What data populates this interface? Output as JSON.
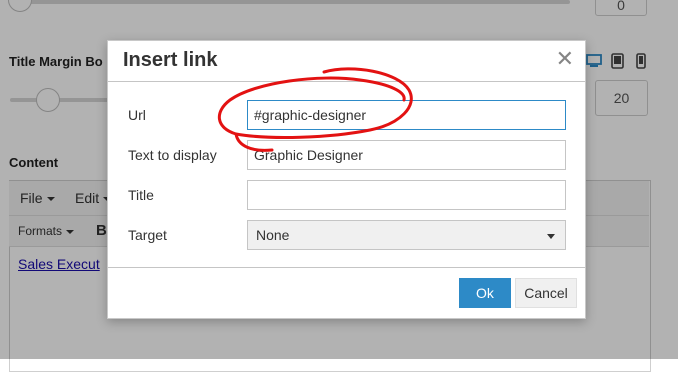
{
  "background": {
    "title_margin_label": "Title Margin Bo",
    "content_label": "Content",
    "slider_value": "20",
    "top_number_value": "0",
    "editor": {
      "menu_file": "File",
      "menu_edit": "Edit",
      "toolbar_formats": "Formats",
      "toolbar_bold": "B",
      "link_text": "Sales Execut"
    },
    "device_icons": [
      "desktop-icon",
      "tablet-icon",
      "mobile-icon"
    ]
  },
  "dialog": {
    "title": "Insert link",
    "close_glyph": "✕",
    "fields": {
      "url": {
        "label": "Url",
        "value": "#graphic-designer"
      },
      "text_to_display": {
        "label": "Text to display",
        "value": "Graphic Designer"
      },
      "title": {
        "label": "Title",
        "value": ""
      },
      "target": {
        "label": "Target",
        "value": "None"
      }
    },
    "ok_label": "Ok",
    "cancel_label": "Cancel"
  },
  "colors": {
    "primary_button": "#2d8ac7",
    "annotation": "#e31212",
    "overlay": "rgba(0,0,0,0.30)"
  }
}
